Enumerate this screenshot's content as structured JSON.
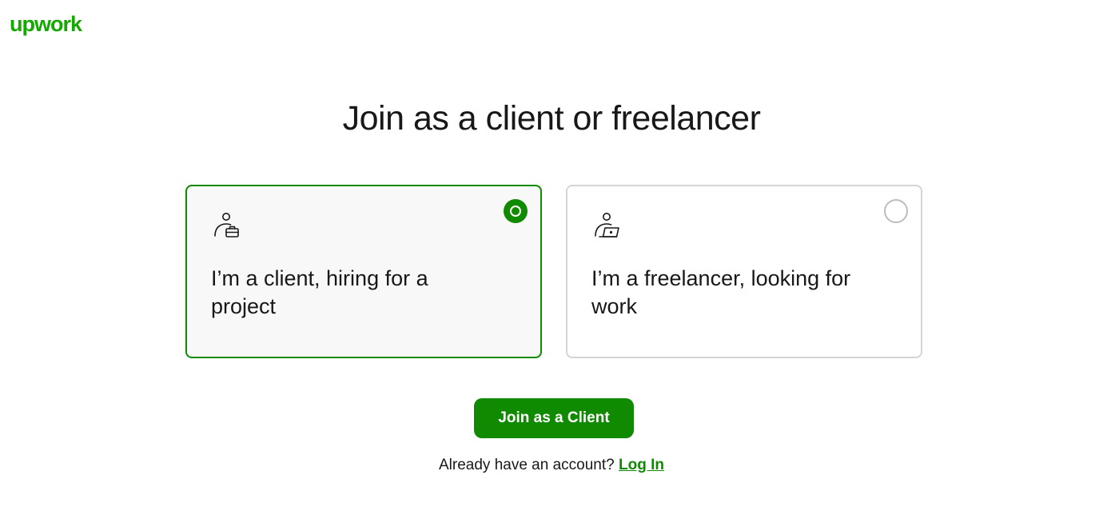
{
  "brand": {
    "logo_text": "upwork",
    "color": "#14a800"
  },
  "page": {
    "title": "Join as a client or freelancer"
  },
  "options": [
    {
      "text": "I’m a client, hiring for a project",
      "icon": "client-briefcase-icon",
      "selected": true
    },
    {
      "text": "I’m a freelancer, looking for work",
      "icon": "freelancer-laptop-icon",
      "selected": false
    }
  ],
  "cta": {
    "label": "Join as a Client",
    "color": "#108a00"
  },
  "login": {
    "prompt": "Already have an account?",
    "link_label": "Log In"
  }
}
